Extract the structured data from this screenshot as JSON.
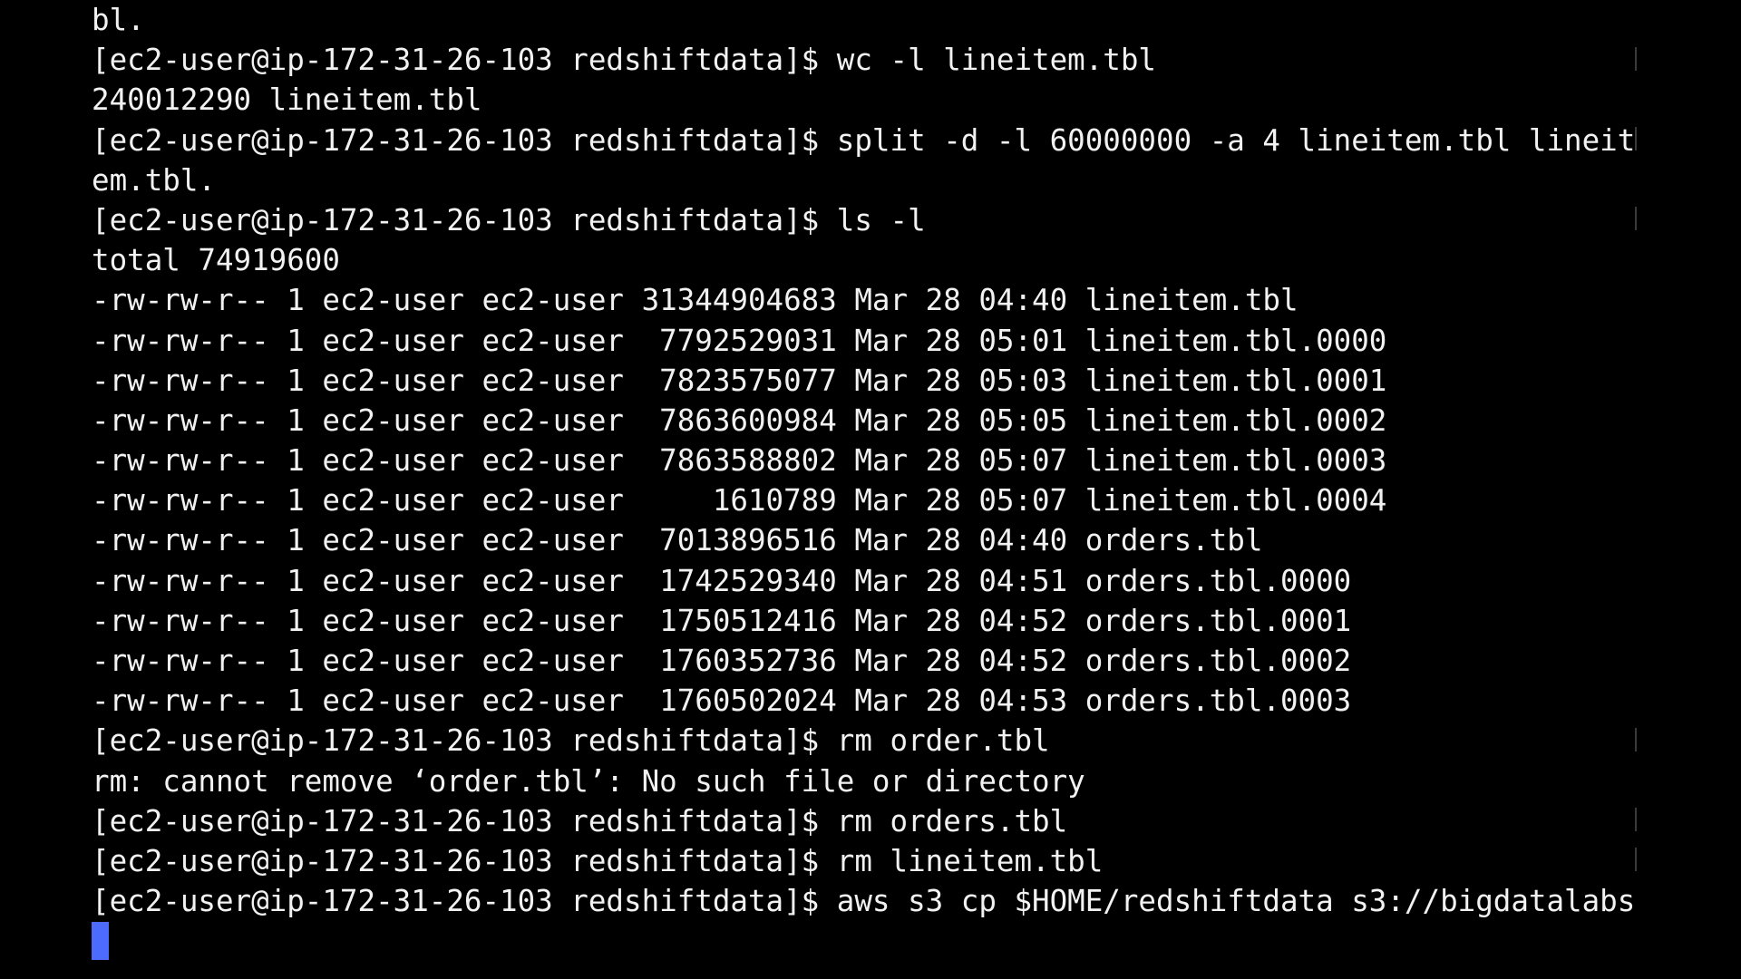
{
  "terminal": {
    "background": "#000000",
    "foreground": "#f2f2f2",
    "cursor_color": "#4d6bff",
    "lines": [
      "bl.",
      "[ec2-user@ip-172-31-26-103 redshiftdata]$ wc -l lineitem.tbl",
      "240012290 lineitem.tbl",
      "[ec2-user@ip-172-31-26-103 redshiftdata]$ split -d -l 60000000 -a 4 lineitem.tbl lineit",
      "em.tbl.",
      "[ec2-user@ip-172-31-26-103 redshiftdata]$ ls -l",
      "total 74919600",
      "-rw-rw-r-- 1 ec2-user ec2-user 31344904683 Mar 28 04:40 lineitem.tbl",
      "-rw-rw-r-- 1 ec2-user ec2-user  7792529031 Mar 28 05:01 lineitem.tbl.0000",
      "-rw-rw-r-- 1 ec2-user ec2-user  7823575077 Mar 28 05:03 lineitem.tbl.0001",
      "-rw-rw-r-- 1 ec2-user ec2-user  7863600984 Mar 28 05:05 lineitem.tbl.0002",
      "-rw-rw-r-- 1 ec2-user ec2-user  7863588802 Mar 28 05:07 lineitem.tbl.0003",
      "-rw-rw-r-- 1 ec2-user ec2-user     1610789 Mar 28 05:07 lineitem.tbl.0004",
      "-rw-rw-r-- 1 ec2-user ec2-user  7013896516 Mar 28 04:40 orders.tbl",
      "-rw-rw-r-- 1 ec2-user ec2-user  1742529340 Mar 28 04:51 orders.tbl.0000",
      "-rw-rw-r-- 1 ec2-user ec2-user  1750512416 Mar 28 04:52 orders.tbl.0001",
      "-rw-rw-r-- 1 ec2-user ec2-user  1760352736 Mar 28 04:52 orders.tbl.0002",
      "-rw-rw-r-- 1 ec2-user ec2-user  1760502024 Mar 28 04:53 orders.tbl.0003",
      "[ec2-user@ip-172-31-26-103 redshiftdata]$ rm order.tbl",
      "rm: cannot remove ‘order.tbl’: No such file or directory",
      "[ec2-user@ip-172-31-26-103 redshiftdata]$ rm orders.tbl",
      "[ec2-user@ip-172-31-26-103 redshiftdata]$ rm lineitem.tbl",
      "[ec2-user@ip-172-31-26-103 redshiftdata]$ aws s3 cp $HOME/redshiftdata s3://bigdatalabs"
    ]
  }
}
